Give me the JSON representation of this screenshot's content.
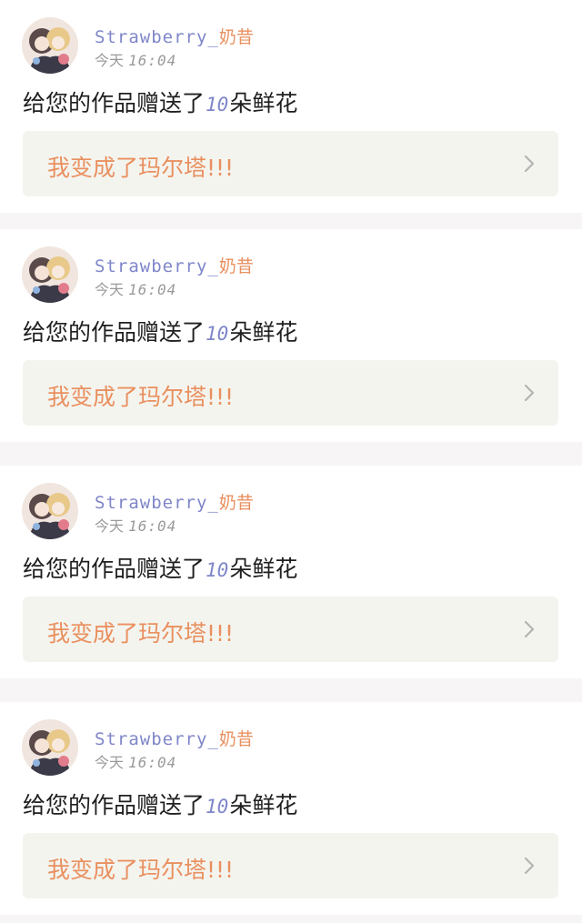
{
  "notifications": [
    {
      "username": "Strawberry_",
      "username_cn": "奶昔",
      "date_label": "今天",
      "time": "16:04",
      "message_before": "给您的作品赠送了",
      "flower_count": "10",
      "message_after": "朵鲜花",
      "work_title": "我变成了玛尔塔!!!"
    },
    {
      "username": "Strawberry_",
      "username_cn": "奶昔",
      "date_label": "今天",
      "time": "16:04",
      "message_before": "给您的作品赠送了",
      "flower_count": "10",
      "message_after": "朵鲜花",
      "work_title": "我变成了玛尔塔!!!"
    },
    {
      "username": "Strawberry_",
      "username_cn": "奶昔",
      "date_label": "今天",
      "time": "16:04",
      "message_before": "给您的作品赠送了",
      "flower_count": "10",
      "message_after": "朵鲜花",
      "work_title": "我变成了玛尔塔!!!"
    },
    {
      "username": "Strawberry_",
      "username_cn": "奶昔",
      "date_label": "今天",
      "time": "16:04",
      "message_before": "给您的作品赠送了",
      "flower_count": "10",
      "message_after": "朵鲜花",
      "work_title": "我变成了玛尔塔!!!"
    }
  ],
  "colors": {
    "username_latin": "#7f86c9",
    "username_cn": "#e9905f",
    "work_title": "#e9905f",
    "page_background": "#f7f5f5",
    "link_background": "#f4f4ef"
  },
  "icons": {
    "avatar": "anime-avatar-image",
    "link_arrow": "chevron-right-icon"
  }
}
